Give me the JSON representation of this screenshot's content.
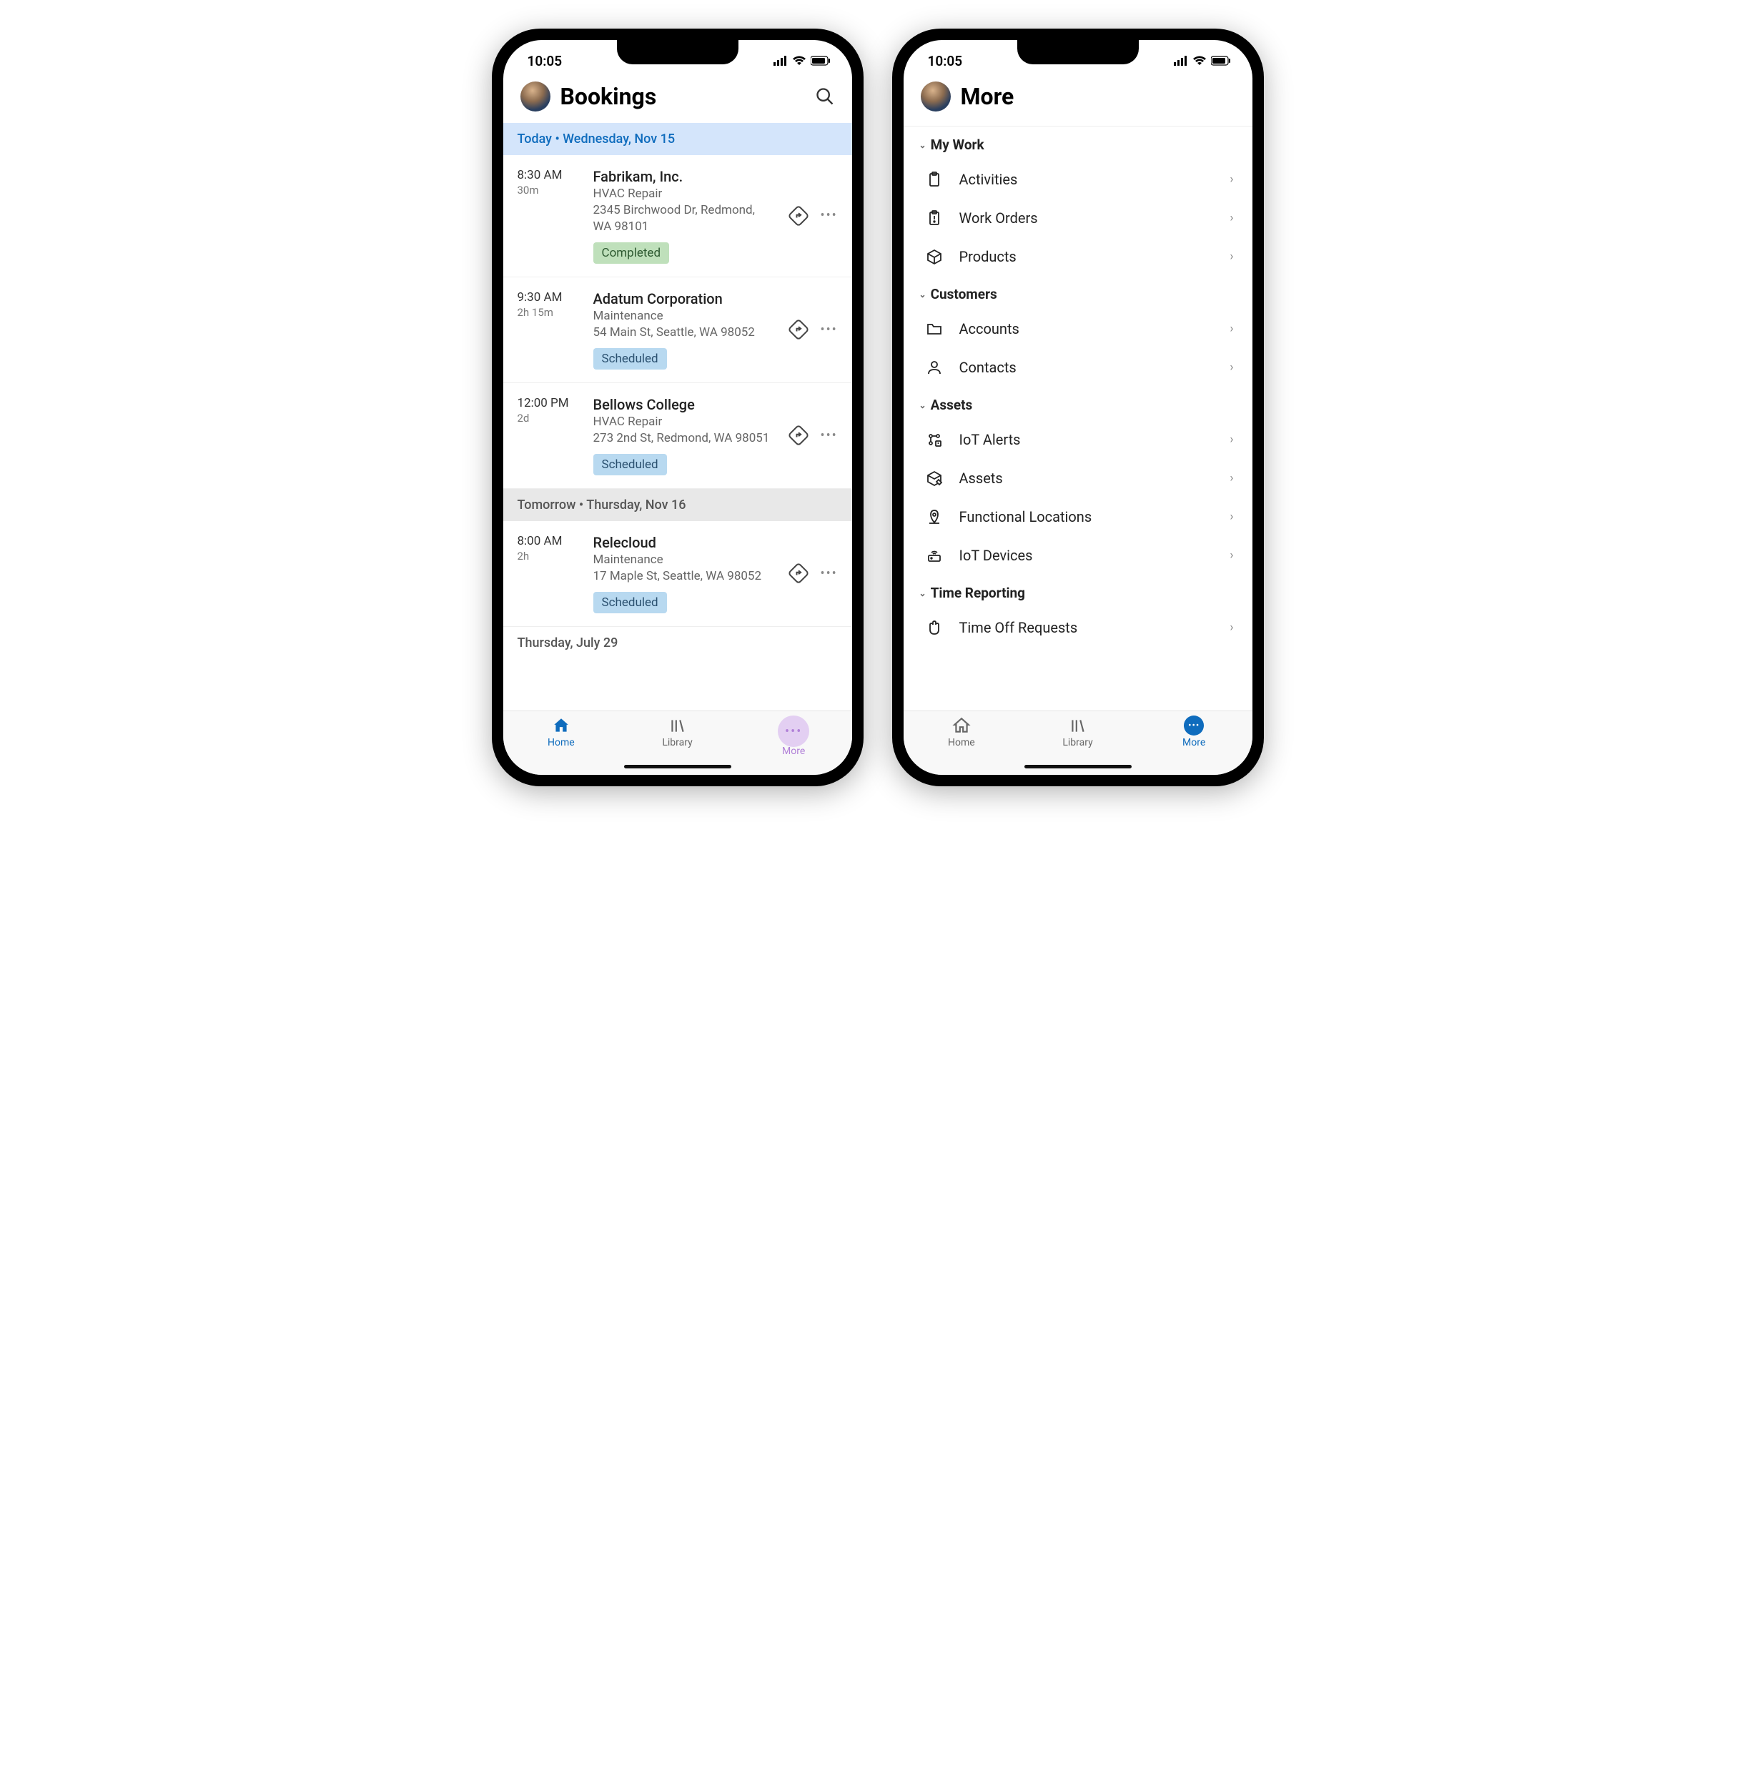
{
  "status_time": "10:05",
  "left": {
    "title": "Bookings",
    "sections": [
      {
        "kind": "today",
        "label": "Today • Wednesday, Nov 15",
        "bookings": [
          {
            "time": "8:30 AM",
            "duration": "30m",
            "company": "Fabrikam, Inc.",
            "type": "HVAC Repair",
            "addr": "2345 Birchwood Dr, Redmond, WA 98101",
            "status": "Completed",
            "status_kind": "completed"
          },
          {
            "time": "9:30 AM",
            "duration": "2h 15m",
            "company": "Adatum Corporation",
            "type": "Maintenance",
            "addr": "54 Main St, Seattle, WA 98052",
            "status": "Scheduled",
            "status_kind": "scheduled"
          },
          {
            "time": "12:00 PM",
            "duration": "2d",
            "company": "Bellows College",
            "type": "HVAC Repair",
            "addr": "273 2nd St, Redmond, WA 98051",
            "status": "Scheduled",
            "status_kind": "scheduled"
          }
        ]
      },
      {
        "kind": "tomorrow",
        "label": "Tomorrow • Thursday, Nov 16",
        "bookings": [
          {
            "time": "8:00 AM",
            "duration": "2h",
            "company": "Relecloud",
            "type": "Maintenance",
            "addr": "17 Maple St, Seattle, WA 98052",
            "status": "Scheduled",
            "status_kind": "scheduled"
          }
        ]
      },
      {
        "kind": "after",
        "label": "Thursday, July 29",
        "bookings": []
      }
    ],
    "tabs": {
      "home": "Home",
      "library": "Library",
      "more": "More"
    },
    "active_tab": "home"
  },
  "right": {
    "title": "More",
    "sections": [
      {
        "title": "My Work",
        "items": [
          {
            "icon": "clipboard",
            "label": "Activities"
          },
          {
            "icon": "clipboard-alert",
            "label": "Work Orders"
          },
          {
            "icon": "box",
            "label": "Products"
          }
        ]
      },
      {
        "title": "Customers",
        "items": [
          {
            "icon": "folder",
            "label": "Accounts"
          },
          {
            "icon": "person",
            "label": "Contacts"
          }
        ]
      },
      {
        "title": "Assets",
        "items": [
          {
            "icon": "iot-alert",
            "label": "IoT Alerts"
          },
          {
            "icon": "box-tag",
            "label": "Assets"
          },
          {
            "icon": "location-pin",
            "label": "Functional Locations"
          },
          {
            "icon": "wifi-device",
            "label": "IoT Devices"
          }
        ]
      },
      {
        "title": "Time Reporting",
        "items": [
          {
            "icon": "palm",
            "label": "Time Off Requests"
          }
        ]
      }
    ],
    "tabs": {
      "home": "Home",
      "library": "Library",
      "more": "More"
    },
    "active_tab": "more"
  }
}
